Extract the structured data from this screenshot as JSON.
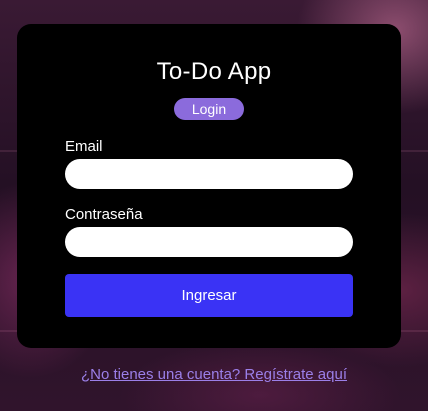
{
  "app": {
    "title": "To-Do App",
    "badge": "Login"
  },
  "form": {
    "email_label": "Email",
    "email_value": "",
    "password_label": "Contraseña",
    "password_value": "",
    "submit_label": "Ingresar"
  },
  "footer": {
    "register_link": "¿No tienes una cuenta? Regístrate aquí"
  },
  "colors": {
    "card": "#000000",
    "badge": "#8b6bdc",
    "button": "#3a33f5",
    "link": "#9b7fe8"
  }
}
